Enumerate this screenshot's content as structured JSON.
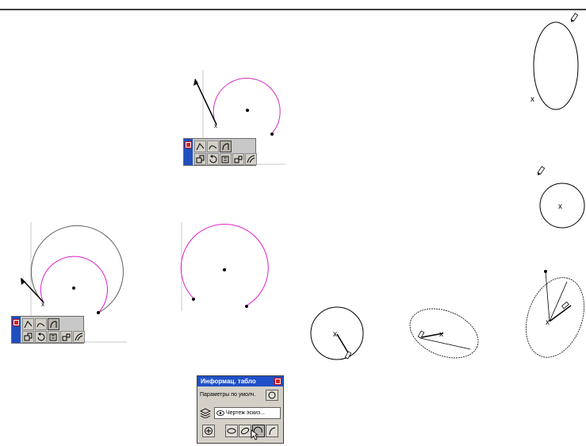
{
  "info_panel": {
    "title": "Информац. табло",
    "default_params_label": "Параметры по умолч.",
    "layer_label": "Чертеж эскиз...",
    "icons": [
      "circle-icon",
      "layer-icon",
      "eye-icon",
      "crosshair-icon",
      "ellipse-icon",
      "arc-icon"
    ]
  },
  "palettes": {
    "arc_tools": [
      "arc-3pt-icon",
      "arc-center-icon",
      "arc-tangent-icon",
      "arc-offset-icon",
      "arc-rotate-icon",
      "arc-copy-icon",
      "arc-mirror-icon",
      "arc-trim-icon"
    ]
  },
  "colors": {
    "magenta_curve": "#e020c8",
    "black_curve": "#000000",
    "guide_line": "#c8c8c8",
    "title_bar": "#2050c8"
  }
}
